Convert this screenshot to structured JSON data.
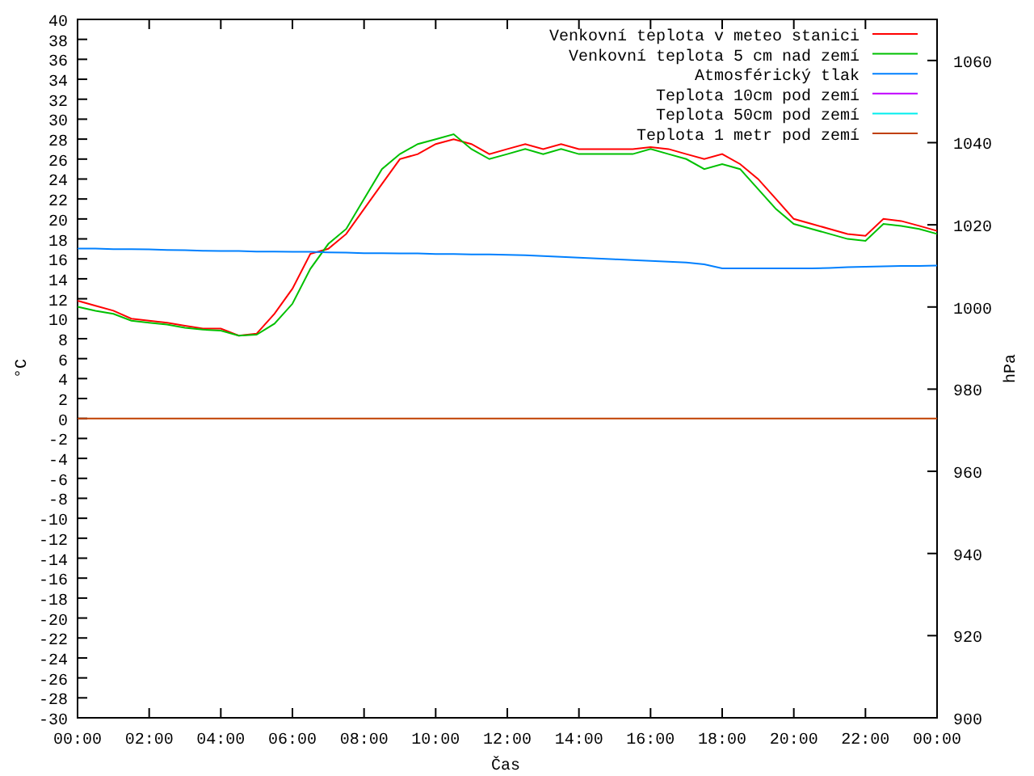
{
  "chart_data": {
    "type": "line",
    "legend": true,
    "xlabel": "Čas",
    "ylabel": "°C",
    "y2label": "hPa",
    "xlim": [
      0,
      24
    ],
    "ylim": [
      -30,
      40
    ],
    "y2lim": [
      900,
      1070
    ],
    "x": [
      0,
      0.5,
      1,
      1.5,
      2,
      2.5,
      3,
      3.5,
      4,
      4.5,
      5,
      5.5,
      6,
      6.5,
      7,
      7.5,
      8,
      8.5,
      9,
      9.5,
      10,
      10.5,
      11,
      11.5,
      12,
      12.5,
      13,
      13.5,
      14,
      14.5,
      15,
      15.5,
      16,
      16.5,
      17,
      17.5,
      18,
      18.5,
      19,
      19.5,
      20,
      20.5,
      21,
      21.5,
      22,
      22.5,
      23,
      23.5,
      24
    ],
    "xticks": [
      {
        "value": 0,
        "label": "00:00"
      },
      {
        "value": 2,
        "label": "02:00"
      },
      {
        "value": 4,
        "label": "04:00"
      },
      {
        "value": 6,
        "label": "06:00"
      },
      {
        "value": 8,
        "label": "08:00"
      },
      {
        "value": 10,
        "label": "10:00"
      },
      {
        "value": 12,
        "label": "12:00"
      },
      {
        "value": 14,
        "label": "14:00"
      },
      {
        "value": 16,
        "label": "16:00"
      },
      {
        "value": 18,
        "label": "18:00"
      },
      {
        "value": 20,
        "label": "20:00"
      },
      {
        "value": 22,
        "label": "22:00"
      },
      {
        "value": 24,
        "label": "00:00"
      }
    ],
    "yticks": [
      40,
      38,
      36,
      34,
      32,
      30,
      28,
      26,
      24,
      22,
      20,
      18,
      16,
      14,
      12,
      10,
      8,
      6,
      4,
      2,
      0,
      -2,
      -4,
      -6,
      -8,
      -10,
      -12,
      -14,
      -16,
      -18,
      -20,
      -22,
      -24,
      -26,
      -28,
      -30
    ],
    "y2ticks": [
      1060,
      1040,
      1020,
      1000,
      980,
      960,
      940,
      920,
      900
    ],
    "series": [
      {
        "name": "Venkovní teplota v meteo stanici",
        "color": "#ff0000",
        "axis": "y",
        "values": [
          11.8,
          11.3,
          10.8,
          10.0,
          9.8,
          9.6,
          9.3,
          9.0,
          9.0,
          8.3,
          8.5,
          10.5,
          13,
          16.5,
          17,
          18.5,
          21,
          23.5,
          26,
          26.5,
          27.5,
          28,
          27.5,
          26.5,
          27,
          27.5,
          27,
          27.5,
          27,
          27,
          27,
          27,
          27.2,
          27,
          26.5,
          26,
          26.5,
          25.5,
          24,
          22,
          20,
          19.5,
          19,
          18.5,
          18.3,
          20,
          19.8,
          19.3,
          18.8
        ]
      },
      {
        "name": "Venkovní teplota 5 cm nad zemí",
        "color": "#00c000",
        "axis": "y",
        "values": [
          11.2,
          10.8,
          10.5,
          9.8,
          9.6,
          9.4,
          9.1,
          8.9,
          8.8,
          8.3,
          8.4,
          9.5,
          11.5,
          15,
          17.5,
          19,
          22,
          25,
          26.5,
          27.5,
          28,
          28.5,
          27,
          26,
          26.5,
          27,
          26.5,
          27,
          26.5,
          26.5,
          26.5,
          26.5,
          27,
          26.5,
          26,
          25,
          25.5,
          25,
          23,
          21,
          19.5,
          19,
          18.5,
          18,
          17.8,
          19.5,
          19.3,
          19,
          18.5
        ]
      },
      {
        "name": "Atmosférický tlak",
        "color": "#0080ff",
        "axis": "y2",
        "values": [
          1014.2,
          1014.2,
          1014.1,
          1014.1,
          1014.0,
          1013.9,
          1013.8,
          1013.7,
          1013.6,
          1013.6,
          1013.5,
          1013.5,
          1013.4,
          1013.4,
          1013.3,
          1013.2,
          1013.1,
          1013.1,
          1013.0,
          1013.0,
          1012.9,
          1012.9,
          1012.8,
          1012.8,
          1012.7,
          1012.6,
          1012.4,
          1012.2,
          1012.0,
          1011.8,
          1011.6,
          1011.4,
          1011.2,
          1011.0,
          1010.8,
          1010.4,
          1009.4,
          1009.4,
          1009.4,
          1009.4,
          1009.4,
          1009.4,
          1009.5,
          1009.7,
          1009.8,
          1009.9,
          1010.0,
          1010.0,
          1010.1
        ]
      },
      {
        "name": "Teplota 10cm pod zemí",
        "color": "#c000ff",
        "axis": "y",
        "values": [
          null,
          null,
          null,
          null,
          null,
          null,
          null,
          null,
          null,
          null,
          null,
          null,
          null,
          null,
          null,
          null,
          null,
          null,
          null,
          null,
          null,
          null,
          null,
          null,
          null,
          null,
          null,
          null,
          null,
          null,
          null,
          null,
          null,
          null,
          null,
          null,
          null,
          null,
          null,
          null,
          null,
          null,
          null,
          null,
          null,
          null,
          null,
          null,
          null
        ]
      },
      {
        "name": "Teplota 50cm pod zemí",
        "color": "#00eeee",
        "axis": "y",
        "values": [
          null,
          null,
          null,
          null,
          null,
          null,
          null,
          null,
          null,
          null,
          null,
          null,
          null,
          null,
          null,
          null,
          null,
          null,
          null,
          null,
          null,
          null,
          null,
          null,
          null,
          null,
          null,
          null,
          null,
          null,
          null,
          null,
          null,
          null,
          null,
          null,
          null,
          null,
          null,
          null,
          null,
          null,
          null,
          null,
          null,
          null,
          null,
          null,
          null
        ]
      },
      {
        "name": "Teplota 1 metr pod zemí",
        "color": "#c04000",
        "axis": "y",
        "values": [
          0,
          0,
          0,
          0,
          0,
          0,
          0,
          0,
          0,
          0,
          0,
          0,
          0,
          0,
          0,
          0,
          0,
          0,
          0,
          0,
          0,
          0,
          0,
          0,
          0,
          0,
          0,
          0,
          0,
          0,
          0,
          0,
          0,
          0,
          0,
          0,
          0,
          0,
          0,
          0,
          0,
          0,
          0,
          0,
          0,
          0,
          0,
          0,
          0
        ]
      }
    ]
  }
}
